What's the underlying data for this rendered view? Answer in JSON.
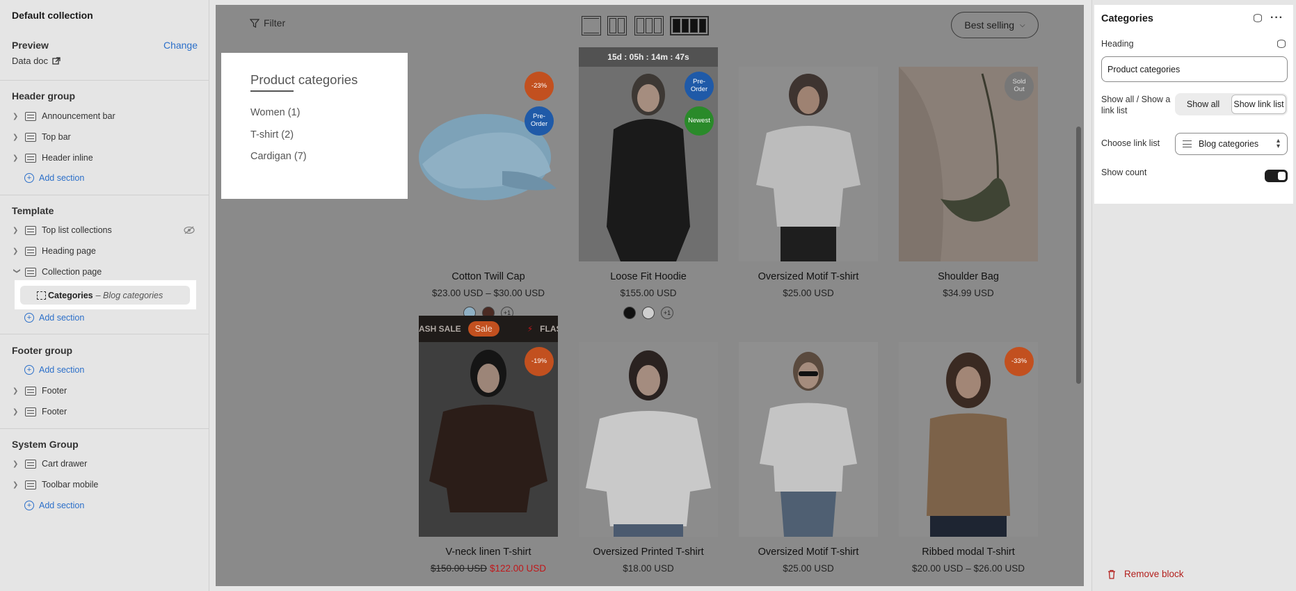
{
  "sidebar": {
    "title": "Default collection",
    "preview_label": "Preview",
    "change_label": "Change",
    "data_doc": "Data doc",
    "header_group": {
      "title": "Header group",
      "items": [
        "Announcement bar",
        "Top bar",
        "Header inline"
      ],
      "add": "Add section"
    },
    "template": {
      "title": "Template",
      "items": [
        "Top list collections",
        "Heading page",
        "Collection page"
      ],
      "selected_block": "Categories",
      "selected_block_sub": "– Blog categories",
      "add": "Add section"
    },
    "footer_group": {
      "title": "Footer group",
      "add": "Add section",
      "items": [
        "Footer",
        "Footer"
      ]
    },
    "system_group": {
      "title": "System Group",
      "items": [
        "Cart drawer",
        "Toolbar mobile"
      ],
      "add": "Add section"
    }
  },
  "preview": {
    "filter_label": "Filter",
    "sort_label": "Best selling",
    "categories": {
      "title": "Product categories",
      "items": [
        "Women (1)",
        "T-shirt (2)",
        "Cardigan (7)"
      ]
    },
    "products": [
      {
        "name": "Cotton Twill Cap",
        "price": "$23.00 USD – $30.00 USD",
        "badges": [
          "-23%",
          "Pre-\nOrder"
        ],
        "swatch_more": "+1"
      },
      {
        "name": "Loose Fit Hoodie",
        "price": "$155.00 USD",
        "badges": [
          "Pre-\nOrder",
          "Newest"
        ],
        "countdown": "15d : 05h : 14m : 47s",
        "swatch_more": "+1"
      },
      {
        "name": "Oversized Motif T-shirt",
        "price": "$25.00 USD"
      },
      {
        "name": "Shoulder Bag",
        "price": "$34.99 USD",
        "badges": [
          "Sold\nOut"
        ]
      },
      {
        "name": "V-neck linen T-shirt",
        "price_old": "$150.00 USD",
        "price_new": "$122.00 USD",
        "badges": [
          "-19%"
        ],
        "flash_left": "ASH SALE",
        "sale_pill": "Sale",
        "flash_right": "FLASH"
      },
      {
        "name": "Oversized Printed T-shirt",
        "price": "$18.00 USD"
      },
      {
        "name": "Oversized Motif T-shirt",
        "price": "$25.00 USD"
      },
      {
        "name": "Ribbed modal T-shirt",
        "price": "$20.00 USD – $26.00 USD",
        "badges": [
          "-33%"
        ]
      }
    ]
  },
  "panel": {
    "title": "Categories",
    "heading_label": "Heading",
    "heading_value": "Product categories",
    "show_label": "Show all / Show a link list",
    "show_all": "Show all",
    "show_link_list": "Show link list",
    "link_list_label": "Choose link list",
    "link_list_value": "Blog categories",
    "show_count_label": "Show count",
    "show_count": true,
    "remove_label": "Remove block"
  },
  "colors": {
    "accent": "#2b6fc9",
    "badge_orange": "#c2501f",
    "badge_blue": "#1f5aa8",
    "badge_green": "#2a8a2a",
    "sale_red": "#c0171a",
    "danger": "#b3201d"
  }
}
